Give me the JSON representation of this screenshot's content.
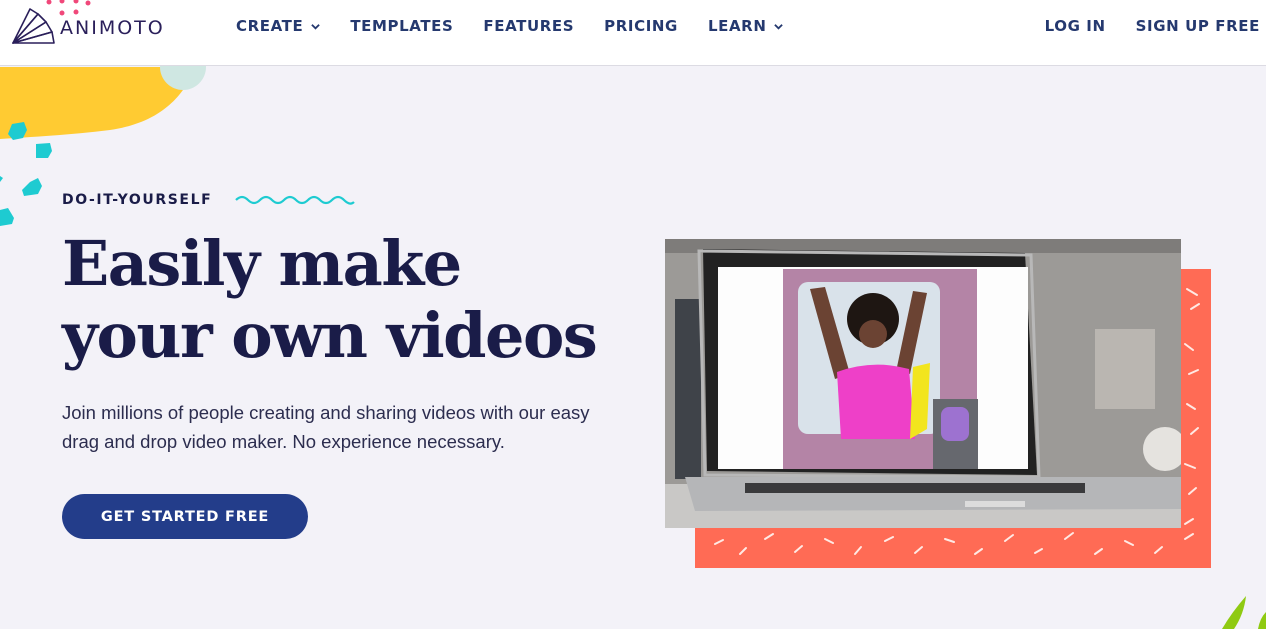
{
  "brand": {
    "name": "ANIMOTO",
    "logo_icon": "fan-logo-icon"
  },
  "header": {
    "nav": [
      {
        "label": "CREATE",
        "has_dropdown": true
      },
      {
        "label": "TEMPLATES",
        "has_dropdown": false
      },
      {
        "label": "FEATURES",
        "has_dropdown": false
      },
      {
        "label": "PRICING",
        "has_dropdown": false
      },
      {
        "label": "LEARN",
        "has_dropdown": true
      }
    ],
    "login_label": "LOG IN",
    "signup_label": "SIGN UP FREE"
  },
  "hero": {
    "eyebrow": "DO-IT-YOURSELF",
    "headline": "Easily make your own videos",
    "subtext": "Join millions of people creating and sharing videos with our easy drag and drop video maker. No experience necessary.",
    "cta_label": "GET STARTED FREE",
    "image_description": "Laptop showing a video of a woman in a pink shirt lifting a purple dumbbell"
  },
  "colors": {
    "nav_text": "#25396f",
    "heading": "#1a1c48",
    "cta_bg": "#233d8a",
    "background": "#f3f2f8",
    "accent_yellow": "#ffcb32",
    "accent_teal": "#1ecbd1",
    "accent_coral": "#ff6b55",
    "accent_pink": "#f0487a",
    "accent_mint": "#cfe7e2",
    "accent_green": "#8fca12"
  }
}
